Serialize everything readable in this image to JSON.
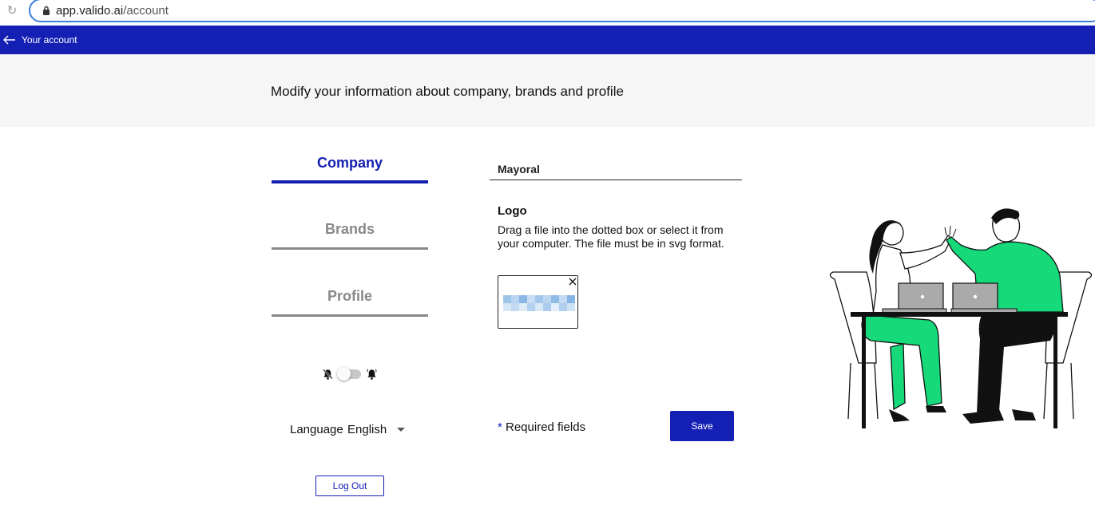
{
  "browser": {
    "url_host": "app.valido.ai",
    "url_path": "/account"
  },
  "header": {
    "title": "Your account"
  },
  "banner": {
    "text": "Modify your information about company, brands and profile"
  },
  "nav": {
    "tabs": [
      {
        "label": "Company",
        "active": true
      },
      {
        "label": "Brands",
        "active": false
      },
      {
        "label": "Profile",
        "active": false
      }
    ]
  },
  "notifications": {
    "enabled": false,
    "off_icon": "bell-off-icon",
    "on_icon": "bell-on-icon"
  },
  "language": {
    "label": "Language",
    "selected": "English"
  },
  "logout_label": "Log Out",
  "form": {
    "company_name": "Mayoral",
    "logo_title": "Logo",
    "logo_help": "Drag a file into the dotted box or select it from your computer. The file must be in svg format.",
    "required_star": "*",
    "required_text": " Required fields",
    "save_label": "Save"
  },
  "colors": {
    "primary": "#1420b4",
    "banner_bg": "#f6f6f6",
    "inactive": "#888888",
    "illustration_green": "#16d97a"
  }
}
